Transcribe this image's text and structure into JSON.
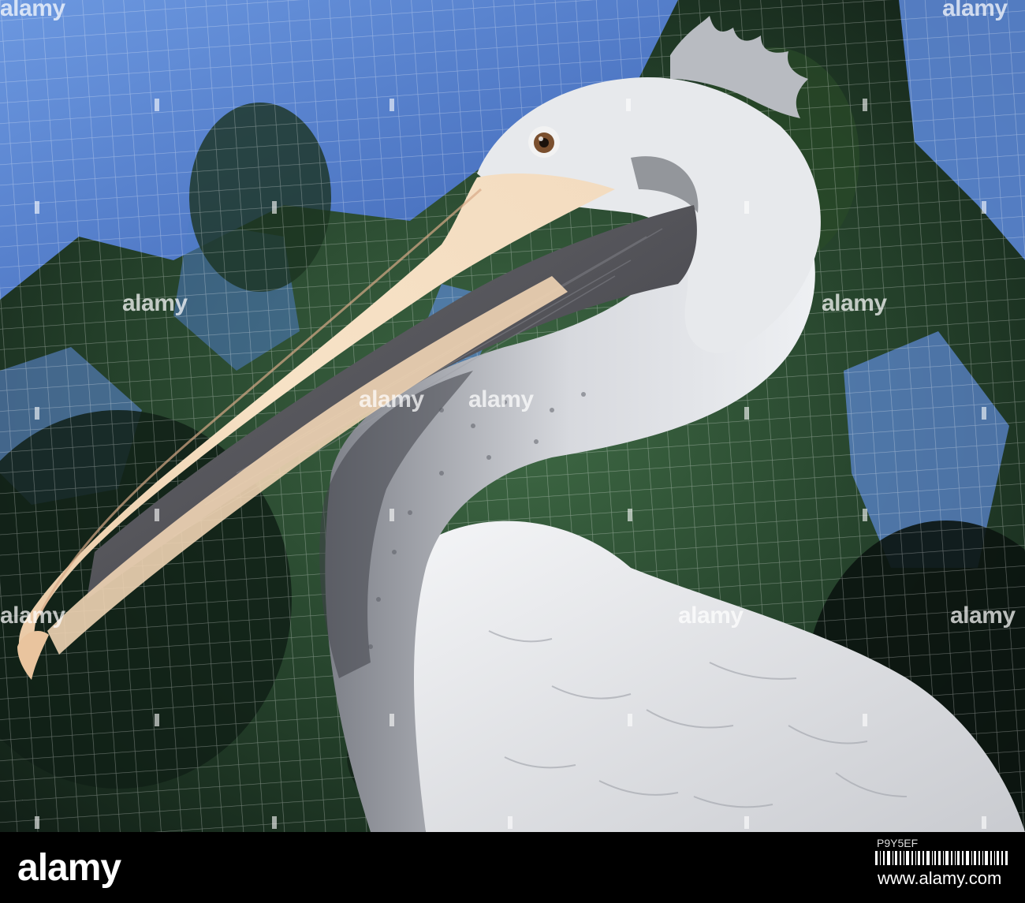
{
  "watermark": {
    "text": "alamy",
    "color": "#ffffff"
  },
  "footer": {
    "logo": "alamy",
    "image_id": "P9Y5EF",
    "url": "www.alamy.com",
    "background": "#000000"
  },
  "photo": {
    "subject": "pelican",
    "background_colors": [
      "#4a79c8",
      "#2f4d2a",
      "#0d1a12"
    ],
    "plumage_color": "#e6e8ec",
    "bill_color": "#f1d7b8"
  }
}
